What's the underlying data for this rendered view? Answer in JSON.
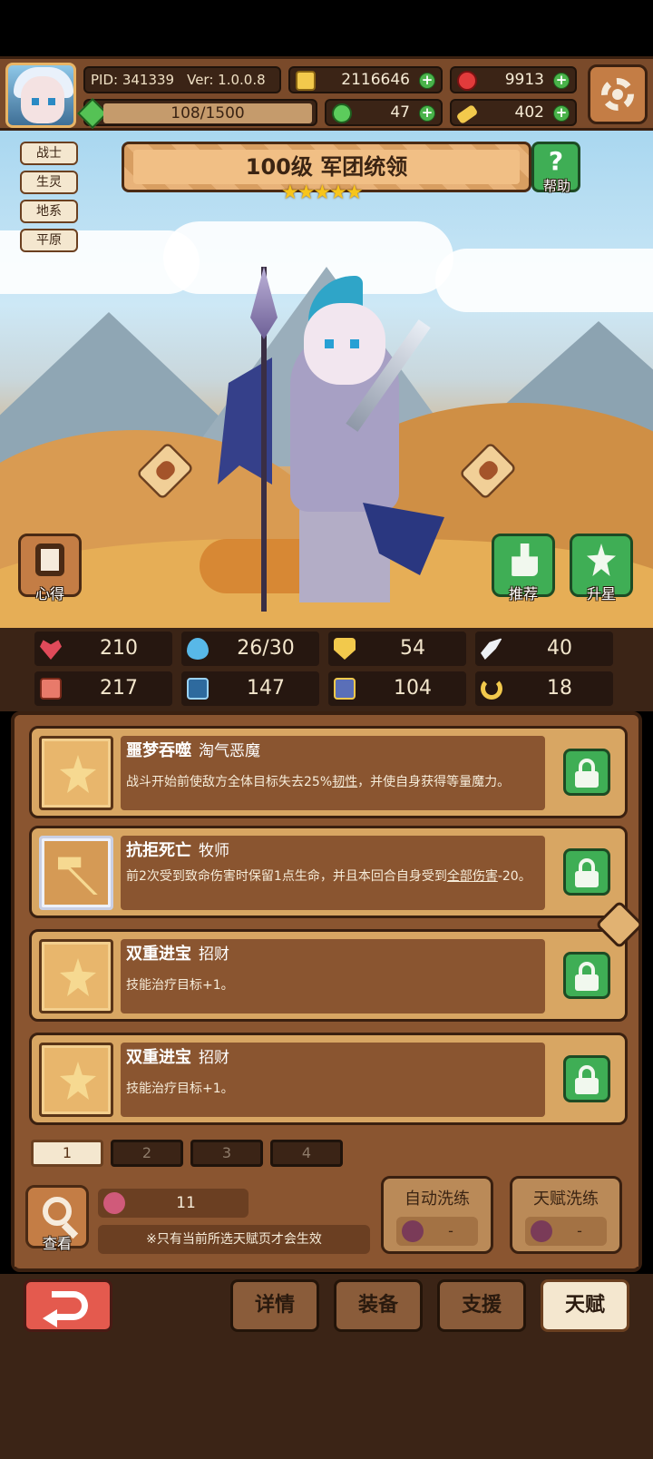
{
  "topbar": {
    "pid": "PID: 341339",
    "version": "Ver: 1.0.0.8",
    "gold": "2116646",
    "ruby": "9913",
    "exp": "108/1500",
    "clover": "47",
    "key": "402"
  },
  "tags": [
    "战士",
    "生灵",
    "地系",
    "平原"
  ],
  "hero": {
    "title": "100级 军团统领",
    "stars": "★★★★★",
    "help_label": "帮助",
    "left_button_label": "心得",
    "recommend_label": "推荐",
    "star_up_label": "升星"
  },
  "stats": {
    "hp": "210",
    "mana": "26/30",
    "defense": "54",
    "speed": "40",
    "attack": "217",
    "magic": "147",
    "armor": "104",
    "luck": "18"
  },
  "talents": [
    {
      "name": "噩梦吞噬",
      "sub": "淘气恶魔",
      "desc_pre": "战斗开始前使敌方全体目标失去25%",
      "desc_link": "韧性",
      "desc_post": "，并使自身获得等量魔力。"
    },
    {
      "name": "抗拒死亡",
      "sub": "牧师",
      "desc_pre": "前2次受到致命伤害时保留1点生命，并且本回合自身受到",
      "desc_link": "全部伤害",
      "desc_post": "-20。"
    },
    {
      "name": "双重进宝",
      "sub": "招财",
      "desc_pre": "技能治疗目标+1。",
      "desc_link": "",
      "desc_post": ""
    },
    {
      "name": "双重进宝",
      "sub": "招财",
      "desc_pre": "技能治疗目标+1。",
      "desc_link": "",
      "desc_post": ""
    }
  ],
  "pages": [
    "1",
    "2",
    "3",
    "4"
  ],
  "bottom": {
    "view_label": "查看",
    "fruit_count": "11",
    "notice": "※只有当前所选天赋页才会生效",
    "auto_wash_label": "自动洗练",
    "auto_wash_cost": "-",
    "talent_wash_label": "天赋洗练",
    "talent_wash_cost": "-"
  },
  "nav": [
    "详情",
    "装备",
    "支援",
    "天赋"
  ],
  "colors": {
    "accent_green": "#3fae55",
    "panel_brown": "#8a5530",
    "back_red": "#e45a4e"
  }
}
